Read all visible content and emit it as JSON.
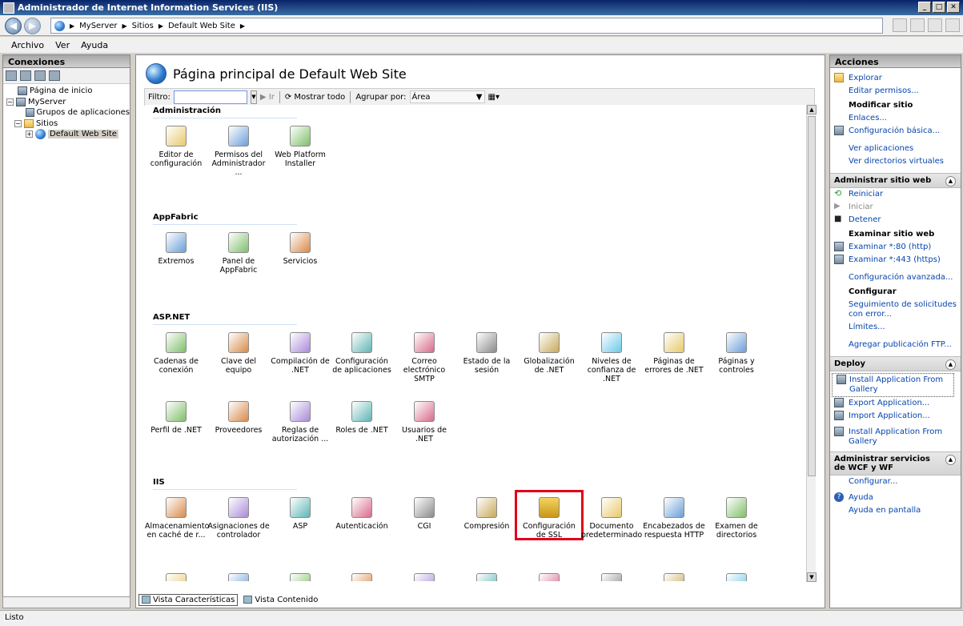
{
  "window": {
    "title": "Administrador de Internet Information Services (IIS)"
  },
  "address": {
    "crumbs": [
      "MyServer",
      "Sitios",
      "Default Web Site"
    ]
  },
  "menu": [
    "Archivo",
    "Ver",
    "Ayuda"
  ],
  "left": {
    "title": "Conexiones",
    "tree": [
      "Página de inicio",
      "MyServer",
      "Grupos de aplicaciones",
      "Sitios",
      "Default Web Site"
    ]
  },
  "center": {
    "title": "Página principal de Default Web Site",
    "filter_label": "Filtro:",
    "go_label": "Ir",
    "show_all": "Mostrar todo",
    "group_label": "Agrupar por:",
    "group_value": "Área",
    "groups": [
      {
        "title": "Administración",
        "features": [
          "Editor de configuración",
          "Permisos del Administrador ...",
          "Web Platform Installer"
        ]
      },
      {
        "title": "AppFabric",
        "features": [
          "Extremos",
          "Panel de AppFabric",
          "Servicios"
        ]
      },
      {
        "title": "ASP.NET",
        "features": [
          "Cadenas de conexión",
          "Clave del equipo",
          "Compilación de .NET",
          "Configuración de aplicaciones",
          "Correo electrónico SMTP",
          "Estado de la sesión",
          "Globalización de .NET",
          "Niveles de confianza de .NET",
          "Páginas de errores de .NET",
          "Páginas y controles",
          "Perfil de .NET",
          "Proveedores",
          "Reglas de autorización ...",
          "Roles de .NET",
          "Usuarios de .NET"
        ]
      },
      {
        "title": "IIS",
        "features": [
          "Almacenamiento en caché de r...",
          "Asignaciones de controlador",
          "ASP",
          "Autenticación",
          "CGI",
          "Compresión",
          "Configuración de SSL",
          "Documento predeterminado",
          "Encabezados de respuesta HTTP",
          "Examen de directorios"
        ]
      }
    ],
    "tabs": [
      "Vista Características",
      "Vista Contenido"
    ]
  },
  "right": {
    "title": "Acciones",
    "explore": "Explorar",
    "edit_perms": "Editar permisos...",
    "modify_site": "Modificar sitio",
    "bindings": "Enlaces...",
    "basic_config": "Configuración básica...",
    "view_apps": "Ver aplicaciones",
    "view_vdirs": "Ver directorios virtuales",
    "manage_site": "Administrar sitio web",
    "restart": "Reiniciar",
    "start": "Iniciar",
    "stop": "Detener",
    "browse_site": "Examinar sitio web",
    "browse80": "Examinar *:80 (http)",
    "browse443": "Examinar *:443 (https)",
    "advanced": "Configuración avanzada...",
    "configure": "Configurar",
    "failed_req": "Seguimiento de solicitudes con error...",
    "limits": "Límites...",
    "add_ftp": "Agregar publicación FTP...",
    "deploy": "Deploy",
    "install_gallery": "Install Application From Gallery",
    "export_app": "Export Application...",
    "import_app": "Import Application...",
    "install_gallery2": "Install Application From Gallery",
    "wcf": "Administrar servicios de WCF y WF",
    "wcf_config": "Configurar...",
    "help": "Ayuda",
    "help_online": "Ayuda en pantalla"
  },
  "status": "Listo",
  "colors": {
    "highlight": "#e0001a",
    "link": "#0645ad"
  }
}
